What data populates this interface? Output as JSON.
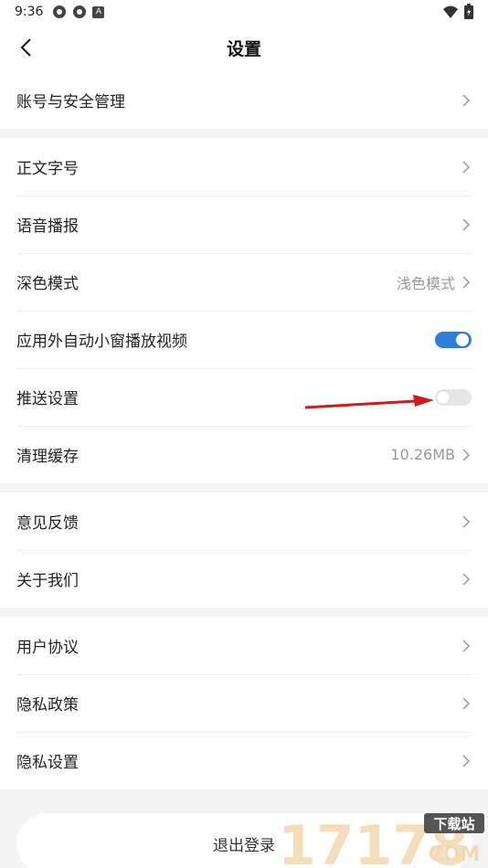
{
  "status_bar": {
    "time": "9:36",
    "badge": "A"
  },
  "header": {
    "title": "设置"
  },
  "groups": [
    {
      "rows": [
        {
          "label": "账号与安全管理"
        }
      ]
    },
    {
      "rows": [
        {
          "label": "正文字号"
        },
        {
          "label": "语音播报"
        },
        {
          "label": "深色模式",
          "value": "浅色模式"
        },
        {
          "label": "应用外自动小窗播放视频",
          "toggle": "on"
        },
        {
          "label": "推送设置",
          "toggle": "off"
        },
        {
          "label": "清理缓存",
          "value": "10.26MB"
        }
      ]
    },
    {
      "rows": [
        {
          "label": "意见反馈"
        },
        {
          "label": "关于我们"
        }
      ]
    },
    {
      "rows": [
        {
          "label": "用户协议"
        },
        {
          "label": "隐私政策"
        },
        {
          "label": "隐私设置"
        }
      ]
    }
  ],
  "logout": {
    "label": "退出登录"
  },
  "colors": {
    "accent": "#2f7ed8",
    "arrow": "#d11a1a"
  },
  "watermark": {
    "text": "17178",
    "badge": "下载站",
    "sub": "COM"
  }
}
